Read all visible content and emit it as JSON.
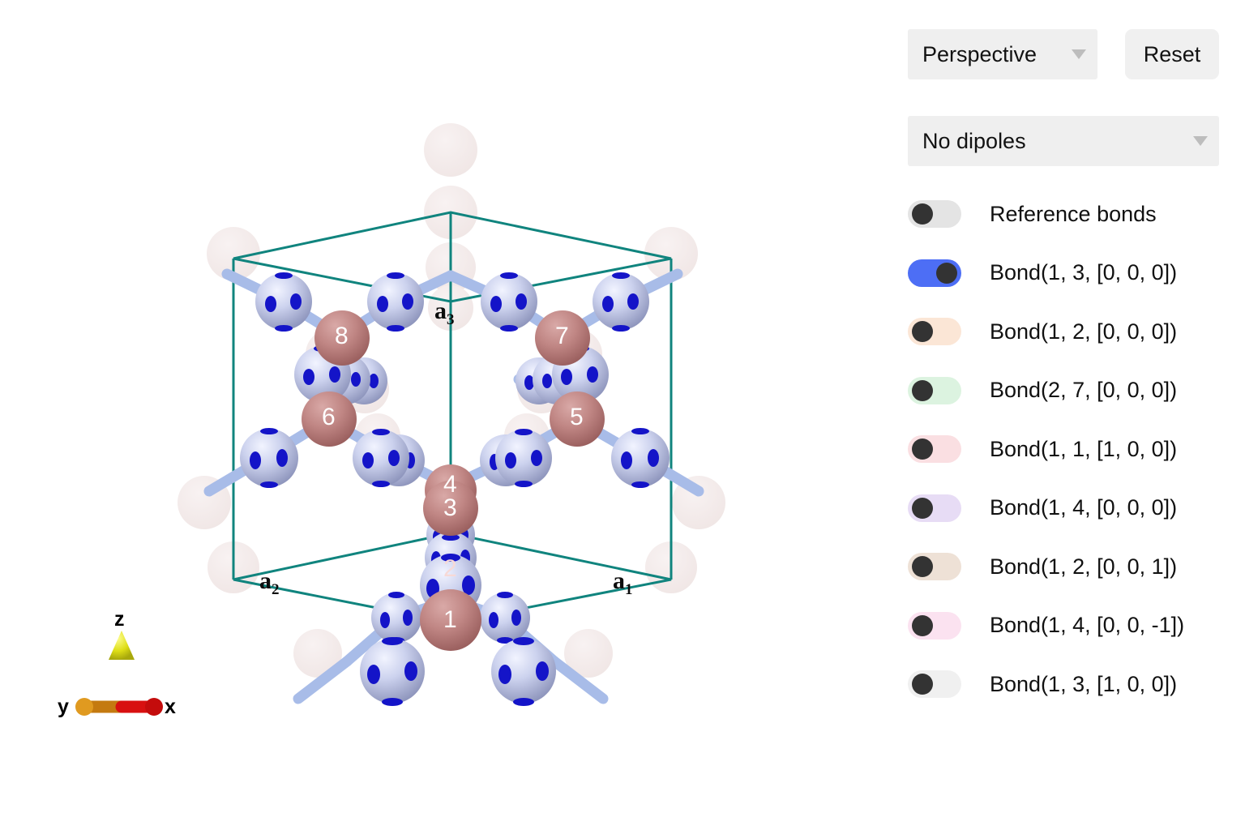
{
  "controls": {
    "projection": {
      "value": "Perspective",
      "caret": "chevron-down-icon"
    },
    "reset": {
      "label": "Reset"
    },
    "dipoles": {
      "value": "No dipoles",
      "caret": "chevron-down-icon"
    }
  },
  "legend": {
    "items": [
      {
        "label": "Reference bonds",
        "on": false,
        "track": "#e4e4e4"
      },
      {
        "label": "Bond(1, 3, [0, 0, 0])",
        "on": true,
        "track": "#4d6ef5"
      },
      {
        "label": "Bond(1, 2, [0, 0, 0])",
        "on": false,
        "track": "#fbe6d6"
      },
      {
        "label": "Bond(2, 7, [0, 0, 0])",
        "on": false,
        "track": "#dcf3e0"
      },
      {
        "label": "Bond(1, 1, [1, 0, 0])",
        "on": false,
        "track": "#fadfe2"
      },
      {
        "label": "Bond(1, 4, [0, 0, 0])",
        "on": false,
        "track": "#e7dcf5"
      },
      {
        "label": "Bond(1, 2, [0, 0, 1])",
        "on": false,
        "track": "#eee1d6"
      },
      {
        "label": "Bond(1, 4, [0, 0, -1])",
        "on": false,
        "track": "#fbe2f0"
      },
      {
        "label": "Bond(1, 3, [1, 0, 0])",
        "on": false,
        "track": "#f0f0f0"
      }
    ]
  },
  "viewport": {
    "cell_vectors": [
      {
        "name": "a1",
        "base": "a",
        "sub": "1"
      },
      {
        "name": "a2",
        "base": "a",
        "sub": "2"
      },
      {
        "name": "a3",
        "base": "a",
        "sub": "3"
      }
    ],
    "axes": [
      {
        "name": "x",
        "label": "x",
        "color": "#d81010"
      },
      {
        "name": "y",
        "label": "y",
        "color": "#d98a12"
      },
      {
        "name": "z",
        "label": "z",
        "color": "#dede16"
      }
    ],
    "atom_labels": [
      "1",
      "2",
      "3",
      "4",
      "5",
      "6",
      "7",
      "8"
    ],
    "colors": {
      "unit_cell": "#10847e",
      "magnetic_atom": "#bf8180",
      "ligand_atom": "#ccd0ec",
      "ligand_spot": "#1414c8",
      "bond": "#a8bce8",
      "ghost_atom": "#f4eceb"
    }
  }
}
